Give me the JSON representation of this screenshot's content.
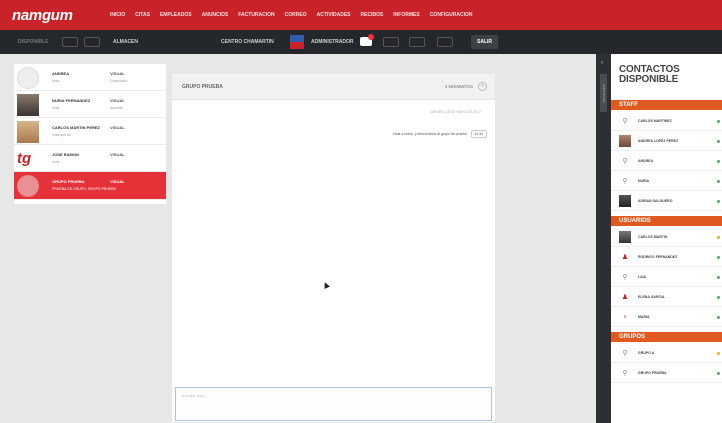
{
  "app": {
    "logo": "namgum"
  },
  "nav": [
    "INICIO",
    "CITAS",
    "EMPLEADOS",
    "ANUNCIOS",
    "FACTURACION",
    "CORREO",
    "ACTIVIDADES",
    "RECIBOS",
    "INFORMES",
    "CONFIGURACION"
  ],
  "toolbar": {
    "left_label": "DISPONIBLE",
    "role_label": "ALMACEN",
    "venue_label": "CENTRO CHAMARTIN",
    "user_label": "ADMINISTRADOR",
    "exit_label": "SALIR"
  },
  "conversations": [
    {
      "name": "ANDREA",
      "subtitle": "Hola",
      "status": "VISUAL",
      "status2": "Conectado"
    },
    {
      "name": "NURIA FERNANDEZ",
      "subtitle": "Hola",
      "status": "VISUAL",
      "status2": "Ausente"
    },
    {
      "name": "CARLOS MARTIN PEREZ",
      "subtitle": "Hola que tal",
      "status": "VISUAL",
      "status2": ""
    },
    {
      "name": "JOSE RAMON",
      "subtitle": "Hola",
      "status": "VISUAL",
      "status2": ""
    },
    {
      "name": "GRUPO PRUEBA",
      "subtitle": "PRUEBA DE GRUPO, GRUPO PRUEBA",
      "status": "VISUAL",
      "status2": ""
    }
  ],
  "chat": {
    "title": "GRUPO PRUEBA",
    "members": "4 MIEMBROS",
    "close_icon": "close-icon",
    "date": "JUEVES, 18 DE MAYO DE 2017",
    "message": "Hola a todos, y bienvenidos al grupo de prueba",
    "message_tag": "11:34",
    "input_placeholder": "Escribe aquí..."
  },
  "side_tab": {
    "label": "CONTACTOS"
  },
  "contacts": {
    "title": "CONTACTOS DISPONIBLE",
    "sections": [
      {
        "label": "STAFF",
        "items": [
          {
            "name": "CARLOS MARTINEZ",
            "icon": "user-icon",
            "status_color": "#4caf50"
          },
          {
            "name": "ANDREA LOPEZ PEREZ",
            "icon": "photo",
            "status_color": "#4caf50"
          },
          {
            "name": "ANDREA",
            "icon": "user-icon",
            "status_color": "#4caf50"
          },
          {
            "name": "NURIA",
            "icon": "user-icon",
            "status_color": "#4caf50"
          },
          {
            "name": "ADRIAN SALGUERO",
            "icon": "photo",
            "status_color": "#4caf50"
          }
        ]
      },
      {
        "label": "USUARIOS",
        "items": [
          {
            "name": "CARLOS MARTIN",
            "icon": "photo",
            "status_color": "#f0b400"
          },
          {
            "name": "RODRIGO FERNANDEZ",
            "icon": "person-icon",
            "status_color": "#4caf50"
          },
          {
            "name": "LAIA",
            "icon": "user-icon",
            "status_color": "#4caf50"
          },
          {
            "name": "ELENA GARCIA",
            "icon": "person-icon",
            "status_color": "#4caf50"
          },
          {
            "name": "MARIA",
            "icon": "woman-icon",
            "status_color": "#4caf50"
          }
        ]
      },
      {
        "label": "GRUPOS",
        "items": [
          {
            "name": "GRUPO A",
            "icon": "user-icon",
            "status_color": "#f0b400"
          },
          {
            "name": "GRUPO PRUEBA",
            "icon": "user-icon",
            "status_color": "#4caf50"
          }
        ]
      }
    ]
  }
}
